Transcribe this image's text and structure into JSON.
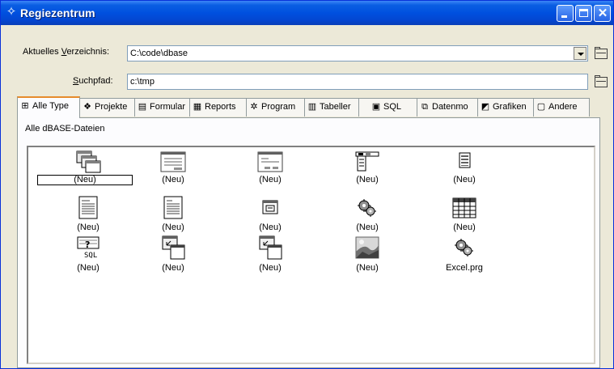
{
  "window": {
    "title": "Regiezentrum",
    "app_icon": "dbase-diamond-icon"
  },
  "directory": {
    "label_prefix": "Aktuelles ",
    "label_accel": "V",
    "label_suffix": "erzeichnis:",
    "value": "C:\\code\\dbase"
  },
  "search_path": {
    "label_accel": "S",
    "label_suffix": "uchpfad:",
    "value": "c:\\tmp"
  },
  "tabs": [
    {
      "label": "Alle Type",
      "icon": "all-types-icon",
      "active": true
    },
    {
      "label": "Projekte",
      "icon": "project-icon"
    },
    {
      "label": "Formular",
      "icon": "form-icon"
    },
    {
      "label": "Reports",
      "icon": "report-icon"
    },
    {
      "label": "Program",
      "icon": "program-icon"
    },
    {
      "label": "Tabeller",
      "icon": "table-icon"
    },
    {
      "label": "SQL",
      "icon": "sql-icon"
    },
    {
      "label": "Datenmo",
      "icon": "datamodule-icon"
    },
    {
      "label": "Grafiken",
      "icon": "image-icon"
    },
    {
      "label": "Andere",
      "icon": "other-icon"
    }
  ],
  "panel": {
    "label": "Alle dBASE-Dateien"
  },
  "items": [
    {
      "caption": "(Neu)",
      "icon": "new-project-icon"
    },
    {
      "caption": "(Neu)",
      "icon": "new-form-icon"
    },
    {
      "caption": "(Neu)",
      "icon": "new-custom-form-icon"
    },
    {
      "caption": "(Neu)",
      "icon": "new-menu-icon"
    },
    {
      "caption": "(Neu)",
      "icon": "new-popup-menu-icon"
    },
    {
      "caption": "(Neu)",
      "icon": "new-report-icon"
    },
    {
      "caption": "(Neu)",
      "icon": "new-label-report-icon"
    },
    {
      "caption": "(Neu)",
      "icon": "new-custom-component-icon"
    },
    {
      "caption": "(Neu)",
      "icon": "new-program-icon"
    },
    {
      "caption": "(Neu)",
      "icon": "new-table-icon"
    },
    {
      "caption": "(Neu)",
      "icon": "new-sql-icon"
    },
    {
      "caption": "(Neu)",
      "icon": "new-datamodule-icon"
    },
    {
      "caption": "(Neu)",
      "icon": "new-custom-datamodule-icon"
    },
    {
      "caption": "(Neu)",
      "icon": "new-image-icon"
    },
    {
      "caption": "Excel.prg",
      "icon": "program-gears-icon"
    }
  ]
}
